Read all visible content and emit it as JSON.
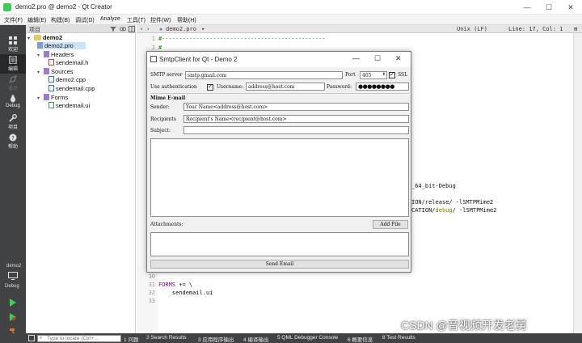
{
  "window": {
    "title": "demo2.pro @ demo2 - Qt Creator",
    "minimize": "—",
    "maximize": "☐",
    "close": "✕"
  },
  "menu": [
    "文件(F)",
    "编辑(E)",
    "构建(B)",
    "调试(D)",
    "Analyze",
    "工具(T)",
    "控件(W)",
    "帮助(H)"
  ],
  "modes": [
    {
      "label": "欢迎",
      "icon": "grid-icon"
    },
    {
      "label": "编辑",
      "icon": "edit-icon"
    },
    {
      "label": "设计",
      "icon": "design-icon"
    },
    {
      "label": "Debug",
      "icon": "bug-icon"
    },
    {
      "label": "项目",
      "icon": "wrench-icon"
    },
    {
      "label": "帮助",
      "icon": "help-icon"
    }
  ],
  "kit": {
    "project": "demo2",
    "config": "Debug"
  },
  "project_pane": {
    "title": "项目"
  },
  "tree": {
    "root": "demo2",
    "pro": "demo2.pro",
    "headers": "Headers",
    "header_file": "sendemail.h",
    "sources": "Sources",
    "source_1": "demo2.cpp",
    "source_2": "sendemail.cpp",
    "forms": "Forms",
    "form_file": "sendemail.ui"
  },
  "editor": {
    "tab": "demo2.pro",
    "encoding": "Unix (LF)",
    "position": "Line: 17, Col: 1",
    "lines": {
      "l1": "#------------------------------------------------",
      "l2": "#",
      "l31_kw": "FORMS",
      "l31_rest": " += \\",
      "l32": "    sendemail.ui",
      "partial_a": "_64_bit-Debug",
      "partial_b_1": "ION/release/ -lSMTPMime2",
      "partial_c_1": "CATION/",
      "partial_c_2": "debug",
      "partial_c_3": "/ -lSMTPMime2"
    },
    "line_numbers": {
      "n1": "1",
      "n2": "2",
      "n30": "30",
      "n31": "31",
      "n32": "32",
      "n33": "33"
    }
  },
  "status": {
    "locator_placeholder": "Type to locate (Ctrl+...",
    "panes": [
      "1 问题",
      "2 Search Results",
      "3 应用程序输出",
      "4 编译输出",
      "5 QML Debugger Console",
      "6 概要信息",
      "8 Test Results"
    ],
    "watermark": "CSDN @音视频开发老舅"
  },
  "dialog": {
    "title": "SmtpClient for Qt - Demo 2",
    "smtp_server_label": "SMTP server",
    "smtp_server_value": "smtp.gmail.com",
    "port_label": "Port",
    "port_value": "465",
    "ssl_label": "SSL",
    "ssl_checked": true,
    "use_auth_label": "Use authentication",
    "use_auth_checked": true,
    "username_label": "Username:",
    "username_value": "address@host.com",
    "password_label": "Password:",
    "password_value": "●●●●●●●●",
    "section_title": "Mime E-mail",
    "sender_label": "Sender:",
    "sender_value": "Your Name<address@host.com>",
    "recipients_label": "Recipients",
    "recipients_value": "Recipient's Name<recipient@host.com>",
    "subject_label": "Subject:",
    "subject_value": "",
    "attachments_label": "Attachments:",
    "add_file_button": "Add File",
    "send_button": "Send Email"
  }
}
